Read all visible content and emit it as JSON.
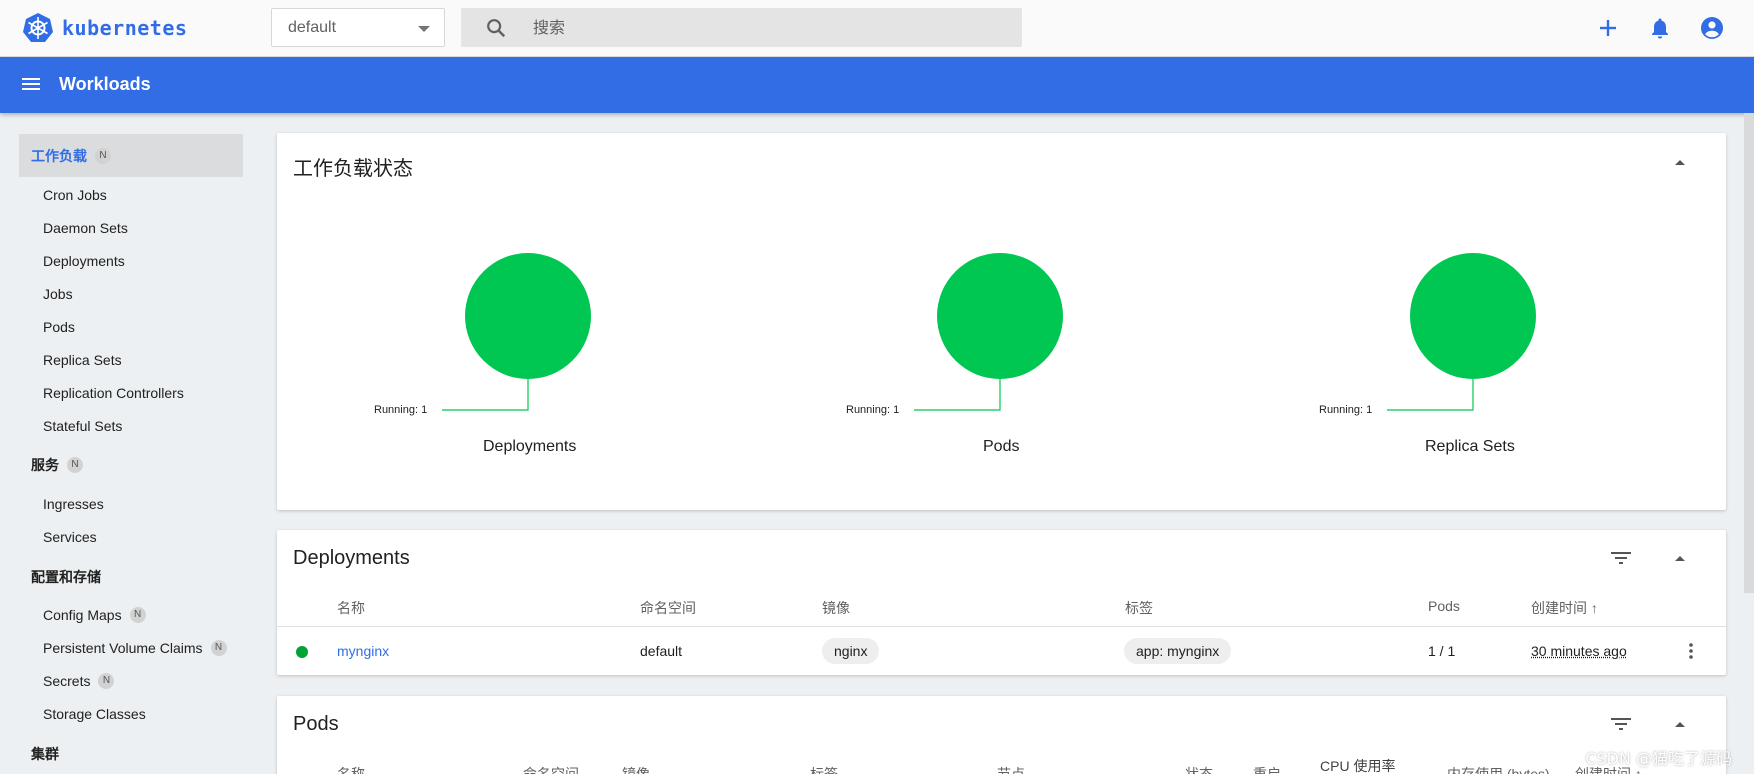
{
  "header": {
    "logo_text": "kubernetes",
    "namespace": "default",
    "search_placeholder": "搜索"
  },
  "appbar": {
    "title": "Workloads"
  },
  "sidebar": {
    "groups": [
      {
        "label": "工作负载",
        "badge": "N",
        "active": true,
        "items": [
          "Cron Jobs",
          "Daemon Sets",
          "Deployments",
          "Jobs",
          "Pods",
          "Replica Sets",
          "Replication Controllers",
          "Stateful Sets"
        ]
      },
      {
        "label": "服务",
        "badge": "N",
        "items": [
          "Ingresses",
          "Services"
        ]
      },
      {
        "label": "配置和存储",
        "items": [
          "Config Maps",
          "Persistent Volume Claims",
          "Secrets",
          "Storage Classes"
        ],
        "item_badges": {
          "Config Maps": "N",
          "Persistent Volume Claims": "N",
          "Secrets": "N"
        }
      },
      {
        "label": "集群"
      }
    ]
  },
  "status_card": {
    "title": "工作负载状态",
    "charts": [
      {
        "name": "Deployments",
        "legend": "Running: 1",
        "running": 1
      },
      {
        "name": "Pods",
        "legend": "Running: 1",
        "running": 1
      },
      {
        "name": "Replica Sets",
        "legend": "Running: 1",
        "running": 1
      }
    ],
    "running_color": "#00c752"
  },
  "deployments_card": {
    "title": "Deployments",
    "columns": [
      "名称",
      "命名空间",
      "镜像",
      "标签",
      "Pods",
      "创建时间"
    ],
    "sort_arrow": "↑",
    "rows": [
      {
        "status_color": "#00a434",
        "name": "mynginx",
        "namespace": "default",
        "image": "nginx",
        "labels": "app: mynginx",
        "pods": "1 / 1",
        "created": "30 minutes ago"
      }
    ]
  },
  "pods_card": {
    "title": "Pods",
    "columns": [
      "名称",
      "命名空间",
      "镜像",
      "标签",
      "节点",
      "状态",
      "重启",
      "CPU 使用率",
      "内存使用 (bytes)",
      "创建时间"
    ],
    "sort_arrow": "↑"
  },
  "watermark": "CSDN @猫吃了源码",
  "colors": {
    "primary": "#326de6",
    "running": "#00c752"
  }
}
